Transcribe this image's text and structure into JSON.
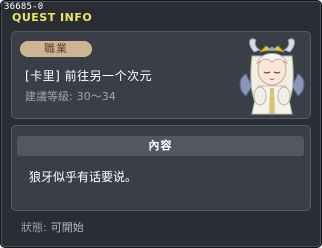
{
  "window": {
    "quest_id": "36685-0",
    "title": "QUEST INFO"
  },
  "quest": {
    "job_label": "職業",
    "name": "[卡里] 前往另一个次元",
    "level_label": "建議等級:",
    "level_range": "30～34"
  },
  "content": {
    "header": "內容",
    "text": "狼牙似乎有话要说。"
  },
  "status": {
    "label": "狀態:",
    "value": "可開始"
  },
  "colors": {
    "title": "#f2e36b",
    "window_bg": "#2a2e34",
    "panel_bg": "#3a3f47",
    "badge_bg": "#cdb494"
  }
}
